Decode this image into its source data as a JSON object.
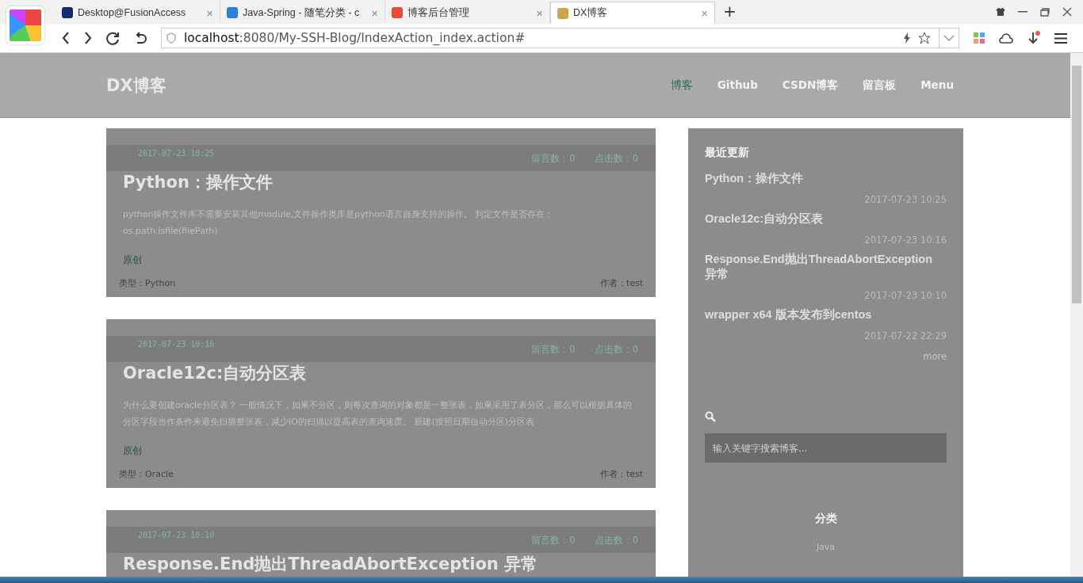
{
  "browser": {
    "tabs": [
      {
        "title": "Desktop@FusionAccess",
        "selected": false
      },
      {
        "title": "Java-Spring - 随笔分类 - c",
        "selected": false
      },
      {
        "title": "博客后台管理",
        "selected": false
      },
      {
        "title": "DX博客",
        "selected": true
      }
    ],
    "tab_close": "×",
    "new_tab": "+",
    "url_host": "localhost",
    "url_rest": ":8080/My-SSH-Blog/IndexAction_index.action#"
  },
  "site": {
    "logo": "DX博客",
    "nav": [
      {
        "label": "博客",
        "selected": true
      },
      {
        "label": "Github",
        "selected": false
      },
      {
        "label": "CSDN博客",
        "selected": false
      },
      {
        "label": "留言板",
        "selected": false
      },
      {
        "label": "Menu",
        "selected": false
      }
    ]
  },
  "posts": [
    {
      "date": "2017-07-23 10:25",
      "comments": "留言数：0",
      "clicks": "点击数：0",
      "title": "Python：操作文件",
      "summary": "python操作文件库不需要安装其他module,文件操作类库是python语言自身支持的操作。 判定文件是否存在：os.path.isfile(filePath)",
      "tag": "原创",
      "type": "类型：Python",
      "author": "作者：test"
    },
    {
      "date": "2017-07-23 10:16",
      "comments": "留言数：0",
      "clicks": "点击数：0",
      "title": "Oracle12c:自动分区表",
      "summary": "为什么要创建oracle分区表？ 一般情况下，如果不分区，则每次查询的对象都是一整张表，如果采用了表分区，那么可以根据具体的分区字段当作条件来避免扫描整张表，减少IO的扫描以提高表的查询速度。 新建(按照日期自动分区)分区表",
      "tag": "原创",
      "type": "类型：Oracle",
      "author": "作者：test"
    },
    {
      "date": "2017-07-23 10:10",
      "comments": "留言数：0",
      "clicks": "点击数：0",
      "title": "Response.End抛出ThreadAbortException 异常"
    }
  ],
  "sidebar": {
    "recent_title": "最近更新",
    "recent": [
      {
        "title": "Python：操作文件",
        "date": "2017-07-23 10:25"
      },
      {
        "title": "Oracle12c:自动分区表",
        "date": "2017-07-23 10:16"
      },
      {
        "title": "Response.End抛出ThreadAbortException 异常",
        "date": "2017-07-23 10:10"
      },
      {
        "title": "wrapper x64 版本发布到centos",
        "date": "2017-07-22 22:29"
      }
    ],
    "more": "more",
    "search": {
      "placeholder": "输入关键字搜索博客..."
    },
    "category_title": "分类",
    "categories": [
      "Java"
    ]
  }
}
